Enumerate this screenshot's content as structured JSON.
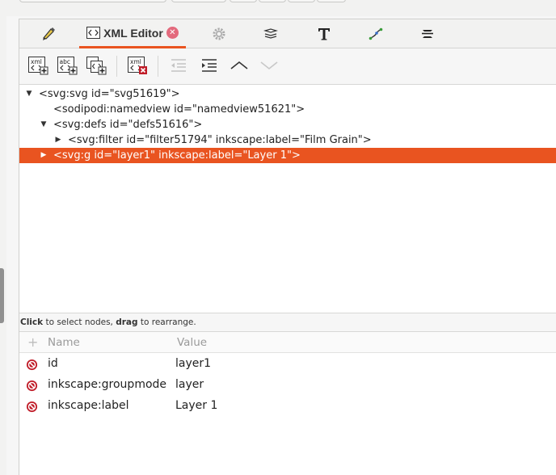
{
  "tabs": {
    "xml_editor_label": "XML Editor",
    "close_glyph": "✕",
    "icons": [
      "pen-icon",
      "xml-editor-icon",
      "gear-icon",
      "layers-icon",
      "text-icon",
      "path-effects-icon",
      "align-icon"
    ]
  },
  "toolbar": {
    "new_element_node_label": "xml",
    "new_text_node_label": "abc",
    "delete_node_label": "xml"
  },
  "tree": {
    "nodes": [
      {
        "text": "<svg:svg id=\"svg51619\">",
        "arrow": "expanded"
      },
      {
        "text": "<sodipodi:namedview id=\"namedview51621\">",
        "arrow": "none"
      },
      {
        "text": "<svg:defs id=\"defs51616\">",
        "arrow": "expanded"
      },
      {
        "text": "<svg:filter id=\"filter51794\" inkscape:label=\"Film Grain\">",
        "arrow": "collapsed"
      },
      {
        "text": "<svg:g id=\"layer1\" inkscape:label=\"Layer 1\">",
        "arrow": "collapsed",
        "selected": true
      }
    ]
  },
  "hint": {
    "click": "Click",
    "click_rest": " to select nodes, ",
    "drag": "drag",
    "drag_rest": " to rearrange."
  },
  "attributes": {
    "header_name": "Name",
    "header_value": "Value",
    "rows": [
      {
        "name": "id",
        "value": "layer1"
      },
      {
        "name": "inkscape:groupmode",
        "value": "layer"
      },
      {
        "name": "inkscape:label",
        "value": "Layer 1"
      }
    ]
  },
  "colors": {
    "accent": "#e95420",
    "delete_red": "#c01c28"
  }
}
